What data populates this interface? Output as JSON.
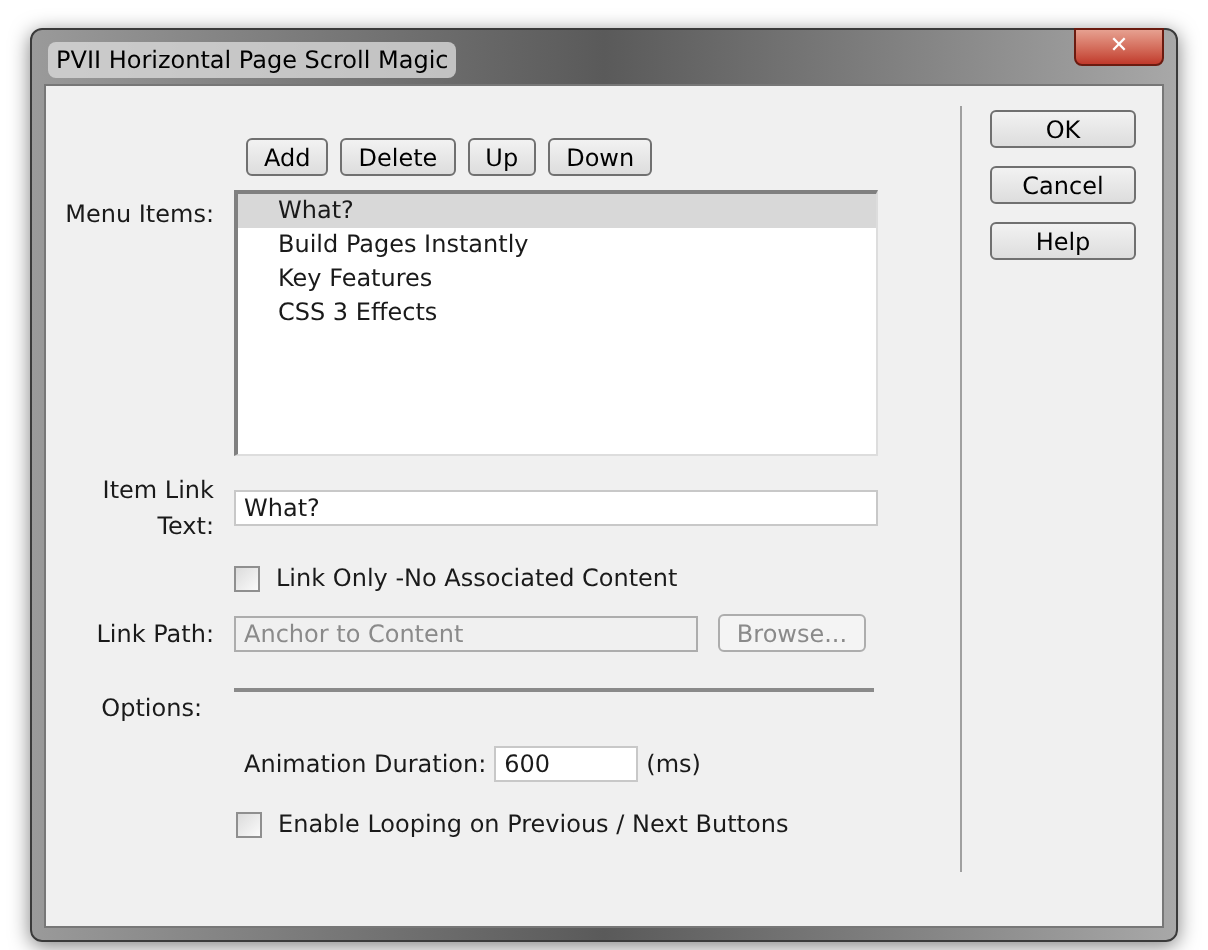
{
  "window": {
    "title": "PVII Horizontal Page Scroll Magic",
    "close": "✕"
  },
  "list_buttons": [
    "Add",
    "Delete",
    "Up",
    "Down"
  ],
  "menu_items": {
    "label": "Menu Items:",
    "items": [
      {
        "text": "What?",
        "selected": true
      },
      {
        "text": "Build Pages Instantly",
        "selected": false
      },
      {
        "text": "Key Features",
        "selected": false
      },
      {
        "text": "CSS 3 Effects",
        "selected": false
      }
    ]
  },
  "item_link_text": {
    "label": "Item Link Text:",
    "value": "What?"
  },
  "link_only": {
    "label": "Link Only -No Associated Content",
    "checked": false
  },
  "link_path": {
    "label": "Link Path:",
    "placeholder": "Anchor to Content",
    "disabled": true,
    "browse": "Browse..."
  },
  "options": {
    "label": "Options:",
    "duration_label": "Animation Duration:",
    "duration": "600",
    "unit": "(ms)",
    "looping": {
      "label": "Enable Looping on Previous / Next Buttons",
      "checked": false
    }
  },
  "side_buttons": [
    "OK",
    "Cancel",
    "Help"
  ]
}
